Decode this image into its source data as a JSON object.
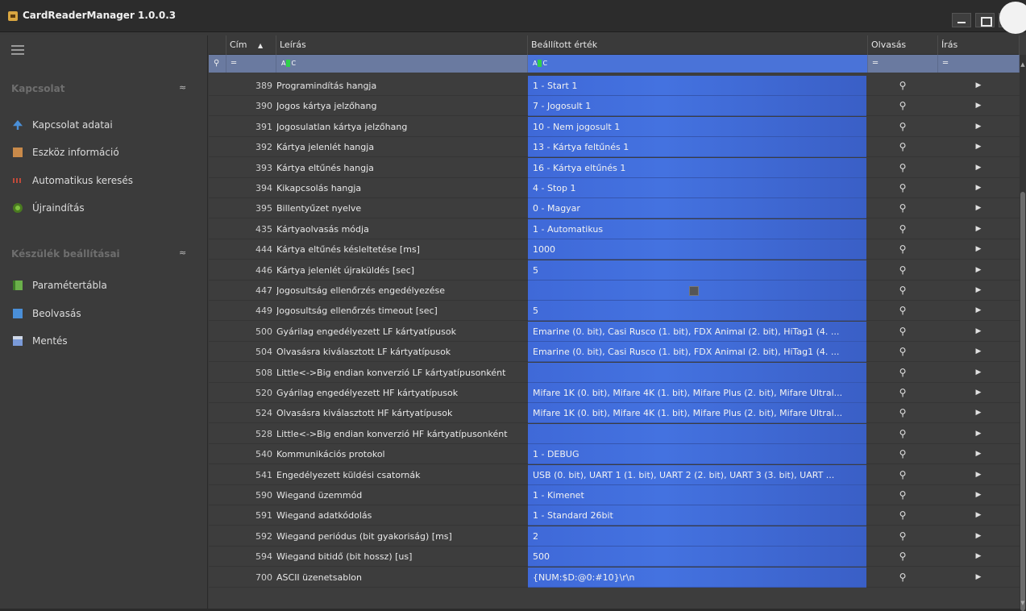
{
  "window": {
    "title": "CardReaderManager 1.0.0.3"
  },
  "sidebar": {
    "groups": [
      {
        "label": "Kapcsolat",
        "items": [
          {
            "label": "Kapcsolat adatai",
            "icon": "network-icon",
            "color": "#4a8fd8"
          },
          {
            "label": "Eszköz információ",
            "icon": "device-info-icon",
            "color": "#c98a4a"
          },
          {
            "label": "Automatikus keresés",
            "icon": "search-scan-icon",
            "color": "#c04a3a"
          },
          {
            "label": "Újraindítás",
            "icon": "restart-gear-icon",
            "color": "#7fc040"
          }
        ]
      },
      {
        "label": "Készülék beállításai",
        "items": [
          {
            "label": "Paramétertábla",
            "icon": "table-icon",
            "color": "#6ab04a"
          },
          {
            "label": "Beolvasás",
            "icon": "read-icon",
            "color": "#4a8fd8"
          },
          {
            "label": "Mentés",
            "icon": "save-icon",
            "color": "#7a9ad8"
          }
        ]
      }
    ]
  },
  "grid": {
    "columns": {
      "id": "Cím",
      "desc": "Leírás",
      "value": "Beállított érték",
      "read": "Olvasás",
      "write": "Írás"
    },
    "rows": [
      {
        "id": "389",
        "desc": "Programindítás hangja",
        "value": "1 - Start 1"
      },
      {
        "id": "390",
        "desc": "Jogos kártya jelzőhang",
        "value": "7 - Jogosult 1"
      },
      {
        "id": "391",
        "desc": "Jogosulatlan kártya jelzőhang",
        "value": "10 - Nem jogosult 1"
      },
      {
        "id": "392",
        "desc": "Kártya jelenlét hangja",
        "value": "13 - Kártya feltűnés 1"
      },
      {
        "id": "393",
        "desc": "Kártya eltűnés hangja",
        "value": "16 - Kártya eltűnés 1"
      },
      {
        "id": "394",
        "desc": "Kikapcsolás hangja",
        "value": "4 - Stop 1"
      },
      {
        "id": "395",
        "desc": "Billentyűzet nyelve",
        "value": "0 - Magyar"
      },
      {
        "id": "435",
        "desc": "Kártyaolvasás módja",
        "value": "1 - Automatikus"
      },
      {
        "id": "444",
        "desc": "Kártya eltűnés késleltetése [ms]",
        "value": "1000"
      },
      {
        "id": "446",
        "desc": "Kártya jelenlét újraküldés [sec]",
        "value": "5"
      },
      {
        "id": "447",
        "desc": "Jogosultság ellenőrzés engedélyezése",
        "value": "",
        "checkbox": true
      },
      {
        "id": "449",
        "desc": "Jogosultság ellenőrzés timeout [sec]",
        "value": "5"
      },
      {
        "id": "500",
        "desc": "Gyárilag engedélyezett LF kártyatípusok",
        "value": "Emarine (0. bit), Casi Rusco (1. bit), FDX Animal (2. bit), HiTag1 (4. ..."
      },
      {
        "id": "504",
        "desc": "Olvasásra kiválasztott LF kártyatípusok",
        "value": "Emarine (0. bit), Casi Rusco (1. bit), FDX Animal (2. bit), HiTag1 (4. ..."
      },
      {
        "id": "508",
        "desc": "Little<->Big endian konverzió LF kártyatípusonként",
        "value": ""
      },
      {
        "id": "520",
        "desc": "Gyárilag engedélyezett HF kártyatípusok",
        "value": "Mifare 1K (0. bit), Mifare 4K (1. bit), Mifare Plus (2. bit), Mifare Ultral..."
      },
      {
        "id": "524",
        "desc": "Olvasásra kiválasztott HF kártyatípusok",
        "value": "Mifare 1K (0. bit), Mifare 4K (1. bit), Mifare Plus (2. bit), Mifare Ultral..."
      },
      {
        "id": "528",
        "desc": "Little<->Big endian konverzió HF kártyatípusonként",
        "value": ""
      },
      {
        "id": "540",
        "desc": "Kommunikációs protokol",
        "value": "1 - DEBUG"
      },
      {
        "id": "541",
        "desc": "Engedélyezett küldési csatornák",
        "value": "USB (0. bit), UART 1 (1. bit), UART 2 (2. bit), UART 3 (3. bit), UART ..."
      },
      {
        "id": "590",
        "desc": "Wiegand üzemmód",
        "value": "1 - Kimenet"
      },
      {
        "id": "591",
        "desc": "Wiegand adatkódolás",
        "value": "1 - Standard 26bit"
      },
      {
        "id": "592",
        "desc": "Wiegand periódus (bit gyakoriság) [ms]",
        "value": "2"
      },
      {
        "id": "594",
        "desc": "Wiegand bitidő (bit hossz) [us]",
        "value": "500"
      },
      {
        "id": "700",
        "desc": "ASCII üzenetsablon",
        "value": "{NUM:$D:@0:#10}\\r\\n"
      }
    ]
  },
  "colors": {
    "accent": "#4472e0",
    "filter_bar": "#6a7aa0"
  }
}
